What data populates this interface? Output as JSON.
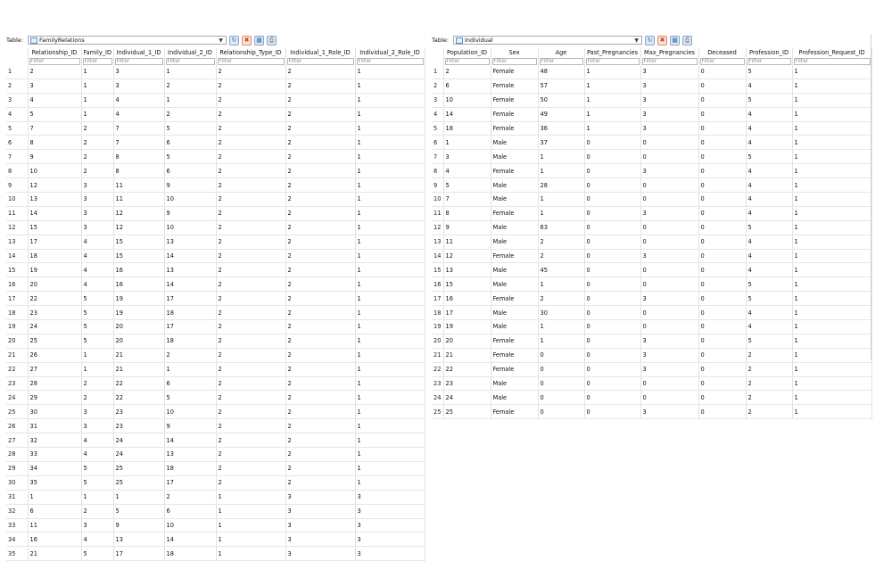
{
  "left": {
    "table_label": "Table:",
    "table_name": "FamilyRelations",
    "columns": [
      "Relationship_ID",
      "Family_ID",
      "Individual_1_ID",
      "Individual_2_ID",
      "Relationship_Type_ID",
      "Individual_1_Role_ID",
      "Individual_2_Role_ID"
    ],
    "filter_placeholder": "Filter",
    "rows": [
      [
        "2",
        "1",
        "3",
        "1",
        "2",
        "2",
        "1"
      ],
      [
        "3",
        "1",
        "3",
        "2",
        "2",
        "2",
        "1"
      ],
      [
        "4",
        "1",
        "4",
        "1",
        "2",
        "2",
        "1"
      ],
      [
        "5",
        "1",
        "4",
        "2",
        "2",
        "2",
        "1"
      ],
      [
        "7",
        "2",
        "7",
        "5",
        "2",
        "2",
        "1"
      ],
      [
        "8",
        "2",
        "7",
        "6",
        "2",
        "2",
        "1"
      ],
      [
        "9",
        "2",
        "8",
        "5",
        "2",
        "2",
        "1"
      ],
      [
        "10",
        "2",
        "8",
        "6",
        "2",
        "2",
        "1"
      ],
      [
        "12",
        "3",
        "11",
        "9",
        "2",
        "2",
        "1"
      ],
      [
        "13",
        "3",
        "11",
        "10",
        "2",
        "2",
        "1"
      ],
      [
        "14",
        "3",
        "12",
        "9",
        "2",
        "2",
        "1"
      ],
      [
        "15",
        "3",
        "12",
        "10",
        "2",
        "2",
        "1"
      ],
      [
        "17",
        "4",
        "15",
        "13",
        "2",
        "2",
        "1"
      ],
      [
        "18",
        "4",
        "15",
        "14",
        "2",
        "2",
        "1"
      ],
      [
        "19",
        "4",
        "16",
        "13",
        "2",
        "2",
        "1"
      ],
      [
        "20",
        "4",
        "16",
        "14",
        "2",
        "2",
        "1"
      ],
      [
        "22",
        "5",
        "19",
        "17",
        "2",
        "2",
        "1"
      ],
      [
        "23",
        "5",
        "19",
        "18",
        "2",
        "2",
        "1"
      ],
      [
        "24",
        "5",
        "20",
        "17",
        "2",
        "2",
        "1"
      ],
      [
        "25",
        "5",
        "20",
        "18",
        "2",
        "2",
        "1"
      ],
      [
        "26",
        "1",
        "21",
        "2",
        "2",
        "2",
        "1"
      ],
      [
        "27",
        "1",
        "21",
        "1",
        "2",
        "2",
        "1"
      ],
      [
        "28",
        "2",
        "22",
        "6",
        "2",
        "2",
        "1"
      ],
      [
        "29",
        "2",
        "22",
        "5",
        "2",
        "2",
        "1"
      ],
      [
        "30",
        "3",
        "23",
        "10",
        "2",
        "2",
        "1"
      ],
      [
        "31",
        "3",
        "23",
        "9",
        "2",
        "2",
        "1"
      ],
      [
        "32",
        "4",
        "24",
        "14",
        "2",
        "2",
        "1"
      ],
      [
        "33",
        "4",
        "24",
        "13",
        "2",
        "2",
        "1"
      ],
      [
        "34",
        "5",
        "25",
        "18",
        "2",
        "2",
        "1"
      ],
      [
        "35",
        "5",
        "25",
        "17",
        "2",
        "2",
        "1"
      ],
      [
        "1",
        "1",
        "1",
        "2",
        "1",
        "3",
        "3"
      ],
      [
        "6",
        "2",
        "5",
        "6",
        "1",
        "3",
        "3"
      ],
      [
        "11",
        "3",
        "9",
        "10",
        "1",
        "3",
        "3"
      ],
      [
        "16",
        "4",
        "13",
        "14",
        "1",
        "3",
        "3"
      ],
      [
        "21",
        "5",
        "17",
        "18",
        "1",
        "3",
        "3"
      ]
    ]
  },
  "right": {
    "table_label": "Table:",
    "table_name": "Individual",
    "columns": [
      "Population_ID",
      "Sex",
      "Age",
      "Past_Pregnancies",
      "Max_Pregnancies",
      "Deceased",
      "Profession_ID",
      "Profession_Request_ID"
    ],
    "filter_placeholder": "Filter",
    "rows": [
      [
        "2",
        "Female",
        "48",
        "1",
        "3",
        "0",
        "5",
        "1"
      ],
      [
        "6",
        "Female",
        "57",
        "1",
        "3",
        "0",
        "4",
        "1"
      ],
      [
        "10",
        "Female",
        "50",
        "1",
        "3",
        "0",
        "5",
        "1"
      ],
      [
        "14",
        "Female",
        "49",
        "1",
        "3",
        "0",
        "4",
        "1"
      ],
      [
        "18",
        "Female",
        "36",
        "1",
        "3",
        "0",
        "4",
        "1"
      ],
      [
        "1",
        "Male",
        "37",
        "0",
        "0",
        "0",
        "4",
        "1"
      ],
      [
        "3",
        "Male",
        "1",
        "0",
        "0",
        "0",
        "5",
        "1"
      ],
      [
        "4",
        "Female",
        "1",
        "0",
        "3",
        "0",
        "4",
        "1"
      ],
      [
        "5",
        "Male",
        "28",
        "0",
        "0",
        "0",
        "4",
        "1"
      ],
      [
        "7",
        "Male",
        "1",
        "0",
        "0",
        "0",
        "4",
        "1"
      ],
      [
        "8",
        "Female",
        "1",
        "0",
        "3",
        "0",
        "4",
        "1"
      ],
      [
        "9",
        "Male",
        "63",
        "0",
        "0",
        "0",
        "5",
        "1"
      ],
      [
        "11",
        "Male",
        "2",
        "0",
        "0",
        "0",
        "4",
        "1"
      ],
      [
        "12",
        "Female",
        "2",
        "0",
        "3",
        "0",
        "4",
        "1"
      ],
      [
        "13",
        "Male",
        "45",
        "0",
        "0",
        "0",
        "4",
        "1"
      ],
      [
        "15",
        "Male",
        "1",
        "0",
        "0",
        "0",
        "5",
        "1"
      ],
      [
        "16",
        "Female",
        "2",
        "0",
        "3",
        "0",
        "5",
        "1"
      ],
      [
        "17",
        "Male",
        "30",
        "0",
        "0",
        "0",
        "4",
        "1"
      ],
      [
        "19",
        "Male",
        "1",
        "0",
        "0",
        "0",
        "4",
        "1"
      ],
      [
        "20",
        "Female",
        "1",
        "0",
        "3",
        "0",
        "5",
        "1"
      ],
      [
        "21",
        "Female",
        "0",
        "0",
        "3",
        "0",
        "2",
        "1"
      ],
      [
        "22",
        "Female",
        "0",
        "0",
        "3",
        "0",
        "2",
        "1"
      ],
      [
        "23",
        "Male",
        "0",
        "0",
        "0",
        "0",
        "2",
        "1"
      ],
      [
        "24",
        "Male",
        "0",
        "0",
        "0",
        "0",
        "2",
        "1"
      ],
      [
        "25",
        "Female",
        "0",
        "0",
        "3",
        "0",
        "2",
        "1"
      ]
    ]
  },
  "icons": {
    "refresh": "refresh-icon",
    "clear_filters": "clear-filters-icon",
    "insert_record": "insert-record-icon",
    "print": "print-icon"
  },
  "colors": {
    "filter_text": "#8e8e8e",
    "refresh_blue": "#2d6fb8",
    "clear_red": "#c2452a"
  }
}
